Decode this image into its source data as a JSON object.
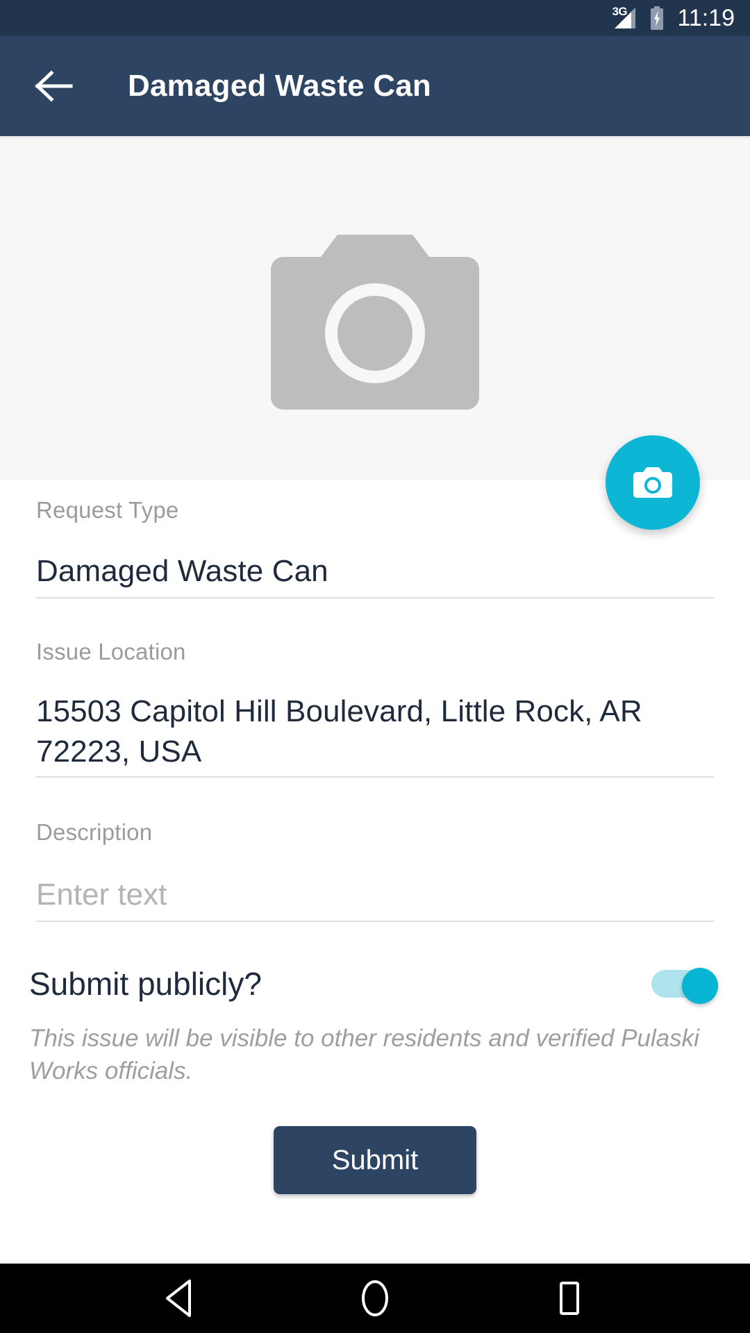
{
  "status_bar": {
    "network_label": "3G",
    "signal_icon": "signal-bars-icon",
    "battery_icon": "battery-charging-icon",
    "time": "11:19"
  },
  "app_bar": {
    "back_icon": "arrow-left-icon",
    "title": "Damaged Waste Can"
  },
  "photo": {
    "placeholder_icon": "camera-placeholder-icon",
    "fab_icon": "camera-icon"
  },
  "form": {
    "request_type": {
      "label": "Request Type",
      "value": "Damaged Waste Can"
    },
    "issue_location": {
      "label": "Issue Location",
      "value": "15503 Capitol Hill Boulevard, Little Rock, AR 72223, USA"
    },
    "description": {
      "label": "Description",
      "placeholder": "Enter text",
      "value": ""
    },
    "public_toggle": {
      "label": "Submit publicly?",
      "state": "on",
      "helper_text": "This issue will be visible to other residents and verified Pulaski Works officials."
    },
    "submit_label": "Submit"
  },
  "nav_bar": {
    "back_icon": "nav-back-triangle-icon",
    "home_icon": "nav-home-circle-icon",
    "recents_icon": "nav-recents-square-icon"
  },
  "colors": {
    "status_bar": "#22354f",
    "app_bar": "#2e4463",
    "accent": "#0cb6d4",
    "toggle_track": "#aee4ee",
    "submit_button": "#2e4463",
    "photo_area": "#f7f7f8",
    "placeholder_gray": "#bdbdbd"
  }
}
